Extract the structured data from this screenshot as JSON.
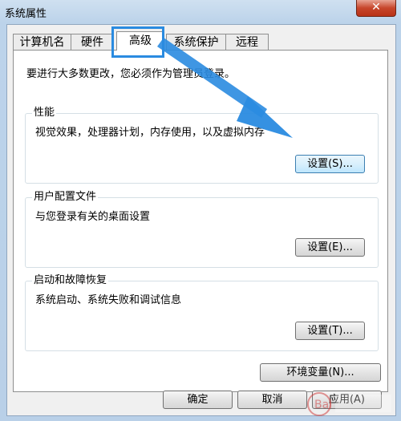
{
  "window": {
    "title": "系统属性",
    "close_glyph": "✕"
  },
  "tabs": [
    {
      "label": "计算机名"
    },
    {
      "label": "硬件"
    },
    {
      "label": "高级"
    },
    {
      "label": "系统保护"
    },
    {
      "label": "远程"
    }
  ],
  "active_tab": "高级",
  "intro": "要进行大多数更改，您必须作为管理员登录。",
  "groups": {
    "performance": {
      "title": "性能",
      "description": "视觉效果，处理器计划，内存使用，以及虚拟内存",
      "button": "设置(S)..."
    },
    "user_profiles": {
      "title": "用户配置文件",
      "description": "与您登录有关的桌面设置",
      "button": "设置(E)..."
    },
    "startup_recovery": {
      "title": "启动和故障恢复",
      "description": "系统启动、系统失败和调试信息",
      "button": "设置(T)..."
    }
  },
  "env_button": "环境变量(N)...",
  "footer": {
    "ok": "确定",
    "cancel": "取消",
    "apply": "应用(A)"
  },
  "colors": {
    "highlight": "#2a8be0",
    "arrow": "#2a8be0"
  }
}
